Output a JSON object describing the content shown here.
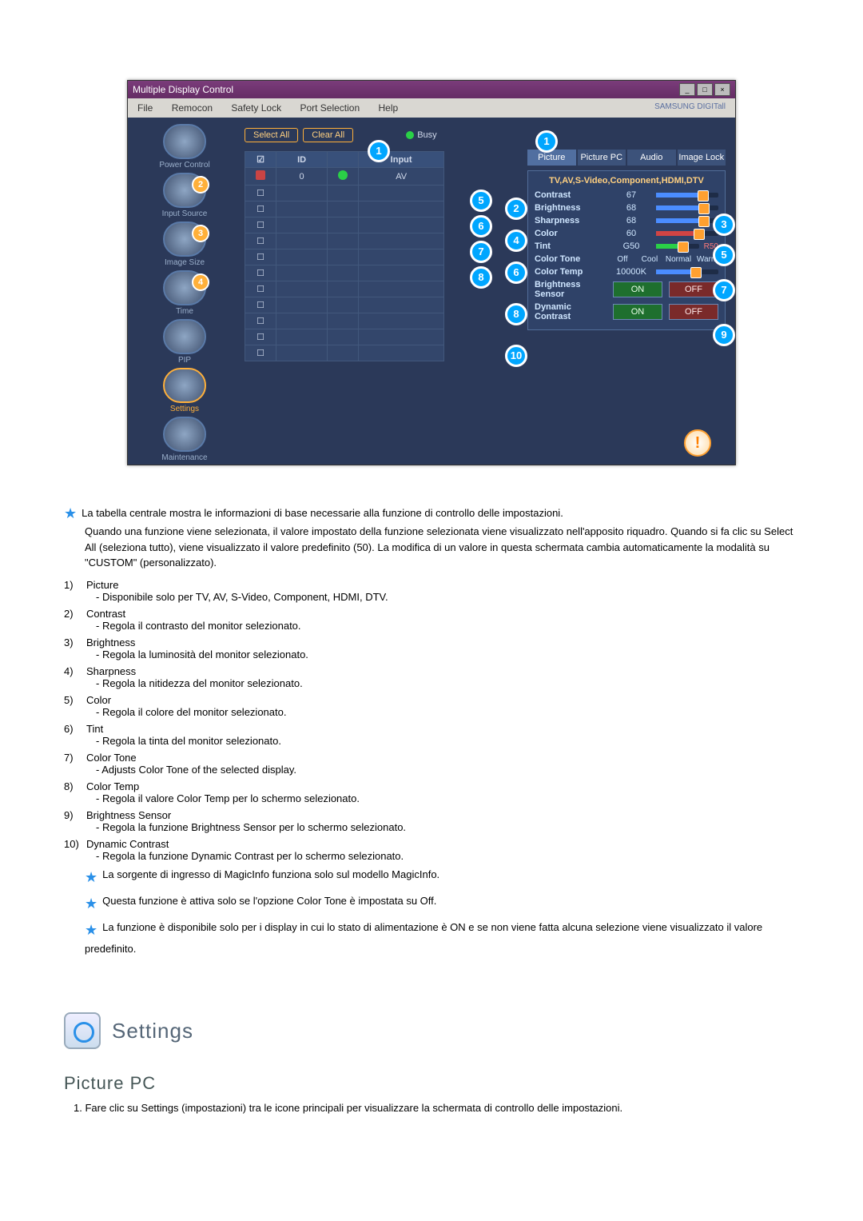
{
  "window": {
    "title": "Multiple Display Control",
    "menus": [
      "File",
      "Remocon",
      "Safety Lock",
      "Port Selection",
      "Help"
    ],
    "brand": "SAMSUNG DIGITall"
  },
  "toolbar": {
    "select_all": "Select All",
    "clear_all": "Clear All",
    "busy": "Busy"
  },
  "sidebar": {
    "items": [
      {
        "label": "Power Control"
      },
      {
        "label": "Input Source",
        "callout": "2"
      },
      {
        "label": "Image Size",
        "callout": "3"
      },
      {
        "label": "Time",
        "callout": "4"
      },
      {
        "label": "PIP"
      },
      {
        "label": "Settings"
      },
      {
        "label": "Maintenance"
      }
    ]
  },
  "grid": {
    "headers": [
      "",
      "ID",
      "",
      "Input"
    ],
    "row1": [
      "",
      "0",
      "",
      "AV"
    ]
  },
  "tabs": {
    "picture": "Picture",
    "picture_pc": "Picture PC",
    "audio": "Audio",
    "image_lock": "Image Lock"
  },
  "panel": {
    "head": "TV,AV,S-Video,Component,HDMI,DTV",
    "contrast": {
      "label": "Contrast",
      "val": "67"
    },
    "brightness": {
      "label": "Brightness",
      "val": "68"
    },
    "sharpness": {
      "label": "Sharpness",
      "val": "68"
    },
    "color": {
      "label": "Color",
      "val": "60"
    },
    "tint": {
      "label": "Tint",
      "val": "G50",
      "right": "R50"
    },
    "color_tone": {
      "label": "Color Tone",
      "opts": [
        "Off",
        "Cool",
        "Normal",
        "Warm"
      ]
    },
    "color_temp": {
      "label": "Color Temp",
      "val": "10000K"
    },
    "bsensor": {
      "label": "Brightness Sensor",
      "on": "ON",
      "off": "OFF"
    },
    "dcontrast": {
      "label": "Dynamic Contrast",
      "on": "ON",
      "off": "OFF"
    }
  },
  "callouts_left": {
    "c5": "5",
    "c6": "6",
    "c7": "7",
    "c8": "8"
  },
  "callouts_right": {
    "c1": "1",
    "c2": "2",
    "c3": "3",
    "c4": "4",
    "c5": "5",
    "c6": "6",
    "c7": "7",
    "c8": "8",
    "c9": "9",
    "c10": "10"
  },
  "doc": {
    "intro": [
      "La tabella centrale mostra le informazioni di base necessarie alla funzione di controllo delle impostazioni.",
      "Quando una funzione viene selezionata, il valore impostato della funzione selezionata viene visualizzato nell'apposito riquadro. Quando si fa clic su Select All (seleziona tutto), viene visualizzato il valore predefinito (50). La modifica di un valore in questa schermata cambia automaticamente la modalità su \"CUSTOM\" (personalizzato)."
    ],
    "items": [
      {
        "n": "1)",
        "t": "Picture",
        "d": "- Disponibile solo per TV, AV, S-Video, Component, HDMI, DTV."
      },
      {
        "n": "2)",
        "t": "Contrast",
        "d": "- Regola il contrasto del monitor selezionato."
      },
      {
        "n": "3)",
        "t": "Brightness",
        "d": "- Regola la luminosità del monitor selezionato."
      },
      {
        "n": "4)",
        "t": "Sharpness",
        "d": "- Regola la nitidezza del monitor selezionato."
      },
      {
        "n": "5)",
        "t": "Color",
        "d": "- Regola il colore del monitor selezionato."
      },
      {
        "n": "6)",
        "t": "Tint",
        "d": "- Regola la tinta del monitor selezionato."
      },
      {
        "n": "7)",
        "t": "Color Tone",
        "d": "- Adjusts Color Tone of the selected display."
      },
      {
        "n": "8)",
        "t": "Color Temp",
        "d": "- Regola il valore Color Temp per lo schermo selezionato."
      },
      {
        "n": "9)",
        "t": "Brightness Sensor",
        "d": "- Regola la funzione Brightness Sensor per lo schermo selezionato."
      },
      {
        "n": "10)",
        "t": "Dynamic Contrast",
        "d": "- Regola la funzione Dynamic Contrast per lo schermo selezionato."
      }
    ],
    "notes": [
      "La sorgente di ingresso di MagicInfo funziona solo sul modello MagicInfo.",
      "Questa funzione è attiva solo se l'opzione Color Tone è impostata su Off.",
      "La funzione è disponibile solo per i display in cui lo stato di alimentazione è ON e se non viene fatta alcuna selezione viene visualizzato il valore predefinito."
    ],
    "section_title": "Settings",
    "sub_title": "Picture PC",
    "step1": "1.  Fare clic su Settings (impostazioni) tra le icone principali per visualizzare la schermata di controllo delle impostazioni."
  }
}
